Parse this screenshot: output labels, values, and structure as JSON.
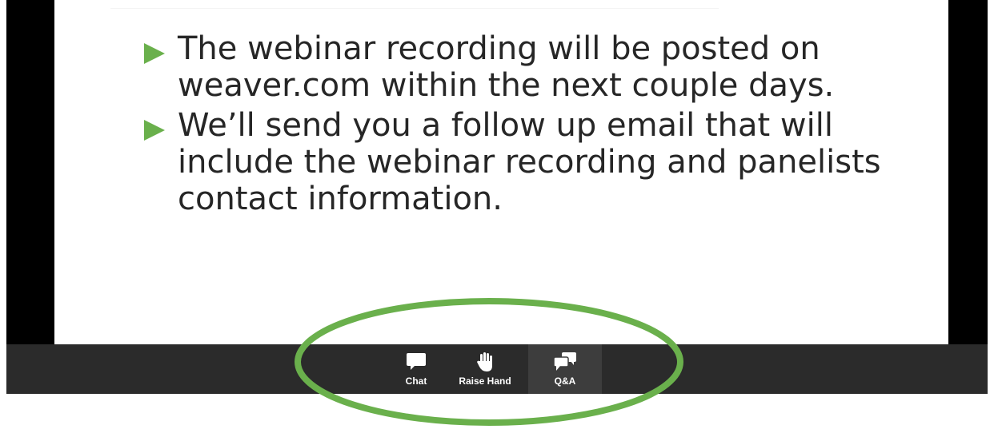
{
  "slide": {
    "bullets": [
      "The webinar recording will be posted on weaver.com within the next couple days.",
      "We’ll send you a follow up email that will include the webinar recording and panelists contact information."
    ]
  },
  "toolbar": {
    "items": [
      {
        "label": "Chat",
        "icon": "chat-icon"
      },
      {
        "label": "Raise Hand",
        "icon": "raise-hand-icon"
      },
      {
        "label": "Q&A",
        "icon": "qa-icon"
      }
    ]
  },
  "colors": {
    "bullet_marker": "#6ab04c",
    "highlight_ring": "#6ab04c",
    "toolbar_bg": "#2b2b2b"
  }
}
